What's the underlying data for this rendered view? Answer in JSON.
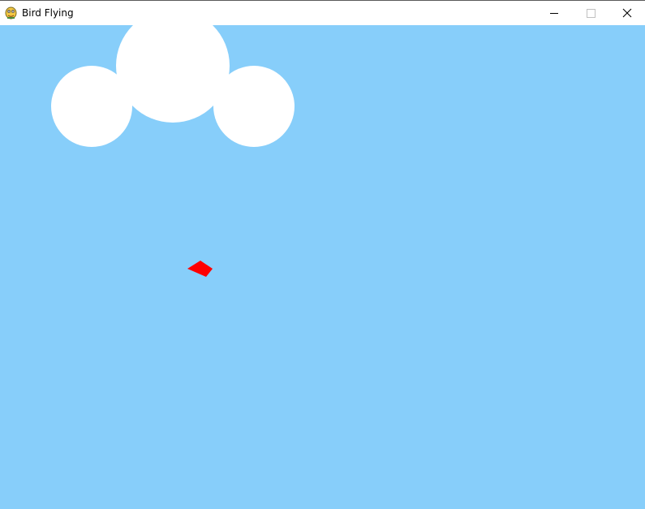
{
  "window": {
    "title": "Bird Flying",
    "app_icon": "pygame-snake-icon",
    "controls": {
      "minimize_icon": "minimize-icon",
      "maximize_icon": "maximize-icon",
      "close_icon": "close-icon"
    }
  },
  "scene": {
    "sky_color": "#87cefa",
    "cloud_color": "#ffffff",
    "bird_color": "#ff0000"
  }
}
